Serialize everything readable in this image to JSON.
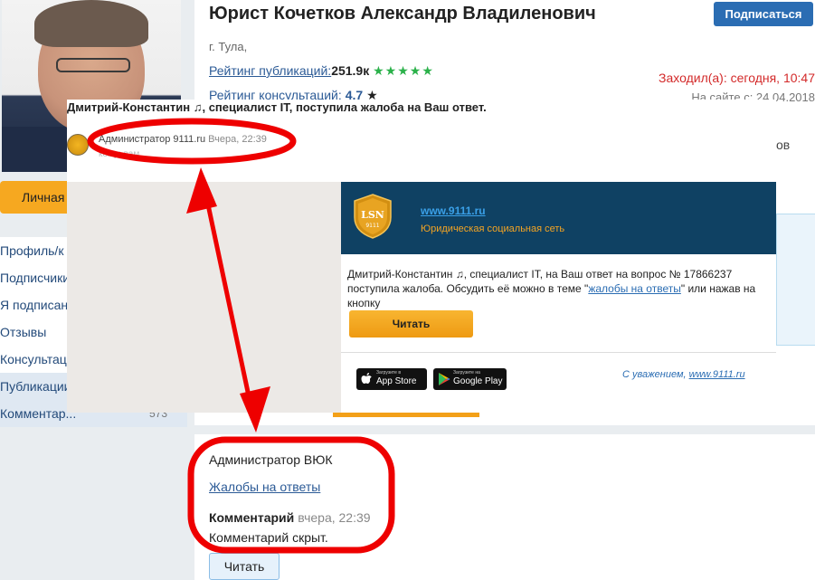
{
  "profile": {
    "name": "Юрист Кочетков Александр Владиленович",
    "subscribe_label": "Подписаться",
    "city": "г. Тула,",
    "pub_rating_label": "Рейтинг публикаций:",
    "pub_rating_value": "251.9к",
    "pub_stars": "★★★★★",
    "consult_rating_label": "Рейтинг консультаций:",
    "consult_rating_value": "4.7",
    "consult_star": "★",
    "visited": "Заходил(а): сегодня, 10:47",
    "since": "На сайте с: 24.04.2018",
    "peek_text": "ов",
    "lk_button": "Личная"
  },
  "sidebar": {
    "items": [
      {
        "label": "Профиль/к",
        "count": ""
      },
      {
        "label": "Подписчики",
        "count": ""
      },
      {
        "label": "Я подписан",
        "count": ""
      },
      {
        "label": "Отзывы",
        "count": ""
      },
      {
        "label": "Консультац",
        "count": ""
      },
      {
        "label": "Публикации",
        "count": ""
      },
      {
        "label": "Комментар...",
        "count": "573"
      }
    ]
  },
  "comment": {
    "author": "Администратор ВЮК",
    "topic_link": "Жалобы на ответы",
    "label": "Комментарий",
    "time": "вчера, 22:39",
    "text": "Комментарий скрыт.",
    "read_button": "Читать"
  },
  "email": {
    "subject": "Дмитрий-Константин ♫, специалист IT, поступила жалоба на Ваш ответ.",
    "sender": "Администратор 9111.ru",
    "sent_time": "Вчера, 22:39",
    "to": "кому: вам",
    "logo_text": "LSN",
    "logo_num": "9111",
    "site_link": "www.9111.ru",
    "site_tagline": "Юридическая социальная сеть",
    "body_part1": "Дмитрий-Константин ♫, специалист IT, на Ваш ответ на вопрос № 17866237 поступила жалоба. Обсудить её можно в теме \"",
    "body_link": "жалобы на ответы",
    "body_part2": "\" или нажав на кнопку",
    "read_button": "Читать",
    "appstore_small": "Загрузите в",
    "appstore_big": "App Store",
    "play_small": "Загрузите на",
    "play_big": "Google Play",
    "regards": "С уважением, ",
    "regards_link": "www.9111.ru"
  },
  "colors": {
    "annotation": "#ee0000",
    "brand_blue": "#0f4163",
    "accent_orange": "#f3a018",
    "link": "#2b5a96"
  }
}
